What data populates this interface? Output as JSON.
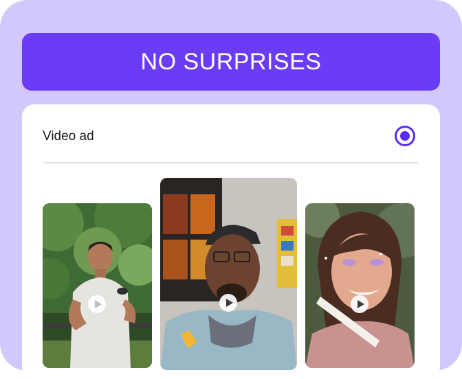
{
  "banner": {
    "title": "NO SURPRISES"
  },
  "option": {
    "label": "Video ad",
    "selected": true
  },
  "videos": [
    {
      "icon": "play-icon"
    },
    {
      "icon": "play-icon"
    },
    {
      "icon": "play-icon"
    }
  ],
  "colors": {
    "panel": "#d2c8fb",
    "banner": "#6a3cf6",
    "radio": "#5b2cf0"
  }
}
